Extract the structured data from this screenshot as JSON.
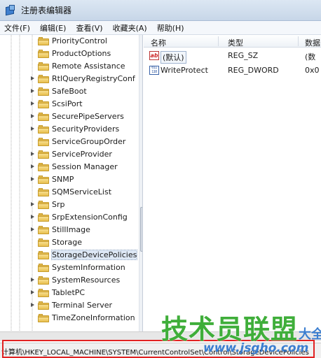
{
  "window": {
    "title": "注册表编辑器"
  },
  "menubar": {
    "items": [
      "文件(F)",
      "编辑(E)",
      "查看(V)",
      "收藏夹(A)",
      "帮助(H)"
    ]
  },
  "tree": {
    "items": [
      {
        "label": "PriorityControl",
        "has_children": false,
        "selected": false
      },
      {
        "label": "ProductOptions",
        "has_children": false,
        "selected": false
      },
      {
        "label": "Remote Assistance",
        "has_children": false,
        "selected": false
      },
      {
        "label": "RtlQueryRegistryConf",
        "has_children": true,
        "selected": false
      },
      {
        "label": "SafeBoot",
        "has_children": true,
        "selected": false
      },
      {
        "label": "ScsiPort",
        "has_children": true,
        "selected": false
      },
      {
        "label": "SecurePipeServers",
        "has_children": true,
        "selected": false
      },
      {
        "label": "SecurityProviders",
        "has_children": true,
        "selected": false
      },
      {
        "label": "ServiceGroupOrder",
        "has_children": false,
        "selected": false
      },
      {
        "label": "ServiceProvider",
        "has_children": true,
        "selected": false
      },
      {
        "label": "Session Manager",
        "has_children": true,
        "selected": false
      },
      {
        "label": "SNMP",
        "has_children": true,
        "selected": false
      },
      {
        "label": "SQMServiceList",
        "has_children": false,
        "selected": false
      },
      {
        "label": "Srp",
        "has_children": true,
        "selected": false
      },
      {
        "label": "SrpExtensionConfig",
        "has_children": true,
        "selected": false
      },
      {
        "label": "StillImage",
        "has_children": true,
        "selected": false
      },
      {
        "label": "Storage",
        "has_children": false,
        "selected": false
      },
      {
        "label": "StorageDevicePolicies",
        "has_children": false,
        "selected": true
      },
      {
        "label": "SystemInformation",
        "has_children": false,
        "selected": false
      },
      {
        "label": "SystemResources",
        "has_children": true,
        "selected": false
      },
      {
        "label": "TabletPC",
        "has_children": true,
        "selected": false
      },
      {
        "label": "Terminal Server",
        "has_children": true,
        "selected": false
      },
      {
        "label": "TimeZoneInformation",
        "has_children": false,
        "selected": false
      }
    ]
  },
  "list": {
    "columns": [
      "名称",
      "类型",
      "数据"
    ],
    "rows": [
      {
        "icon": "string-value-icon",
        "name": "(默认)",
        "type": "REG_SZ",
        "data": "(数"
      },
      {
        "icon": "binary-value-icon",
        "name": "WriteProtect",
        "type": "REG_DWORD",
        "data": "0x0"
      }
    ]
  },
  "statusbar": {
    "path": "计算机\\HKEY_LOCAL_MACHINE\\SYSTEM\\CurrentControlSet\\Control\\StorageDevicePolicies"
  },
  "watermark": {
    "brand": "技术员联盟",
    "url": "www.jsgho.com",
    "suffix": "大全"
  }
}
